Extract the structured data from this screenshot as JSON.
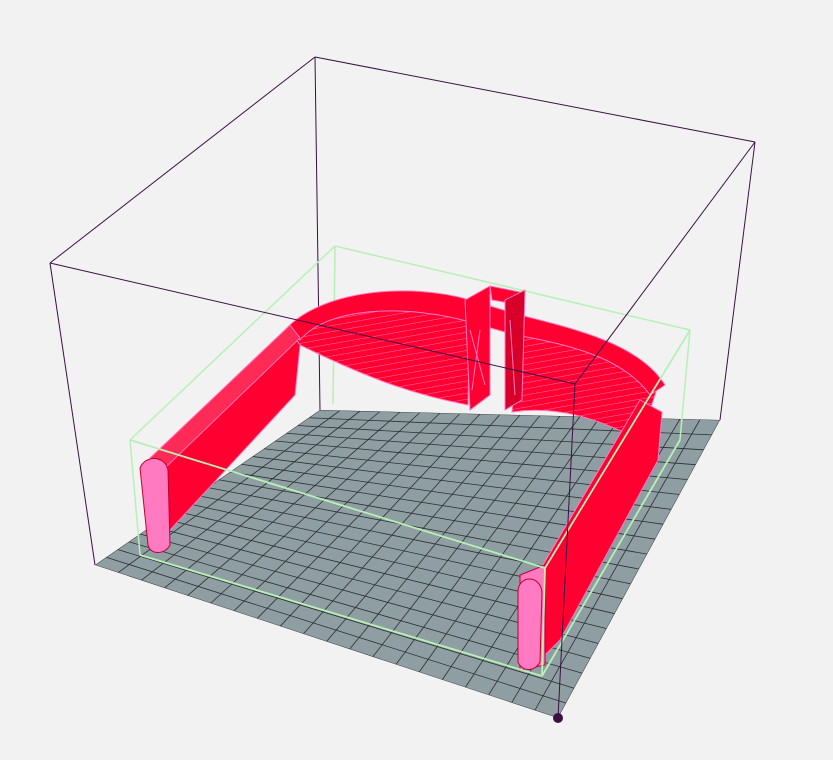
{
  "viewport": {
    "background_color": "#f2f2f2",
    "bed_color": "#8f9ea3",
    "grid_line_color": "#1c1c1c",
    "build_volume_color": "#3b1043",
    "bounding_box_color": "#b7f0b7",
    "model_color": "#ff0030",
    "model_wireframe_color": "#ff7ac0",
    "origin_marker_color": "#3b1043"
  }
}
